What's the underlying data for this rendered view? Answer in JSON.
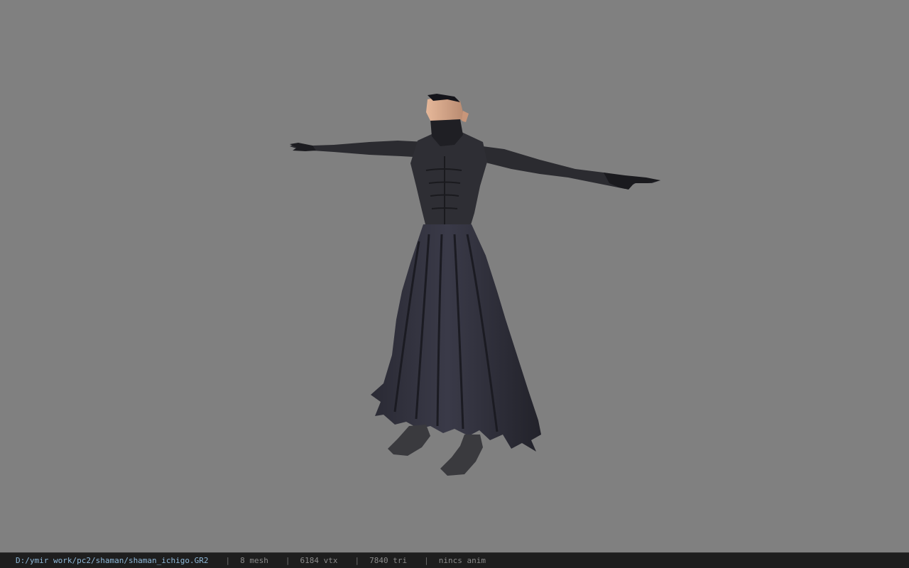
{
  "viewport": {
    "background_color": "#808080",
    "model_description_icon": "character-model"
  },
  "status_bar": {
    "file_path": "D:/ymir work/pc2/shaman/shaman_ichigo.GR2",
    "separator": "|",
    "mesh_count": "8 mesh",
    "vertex_count": "6184 vtx",
    "triangle_count": "7840 tri",
    "anim_status": "nincs anim",
    "path_color": "#8fb8d8",
    "text_color": "#8a8a8a"
  }
}
